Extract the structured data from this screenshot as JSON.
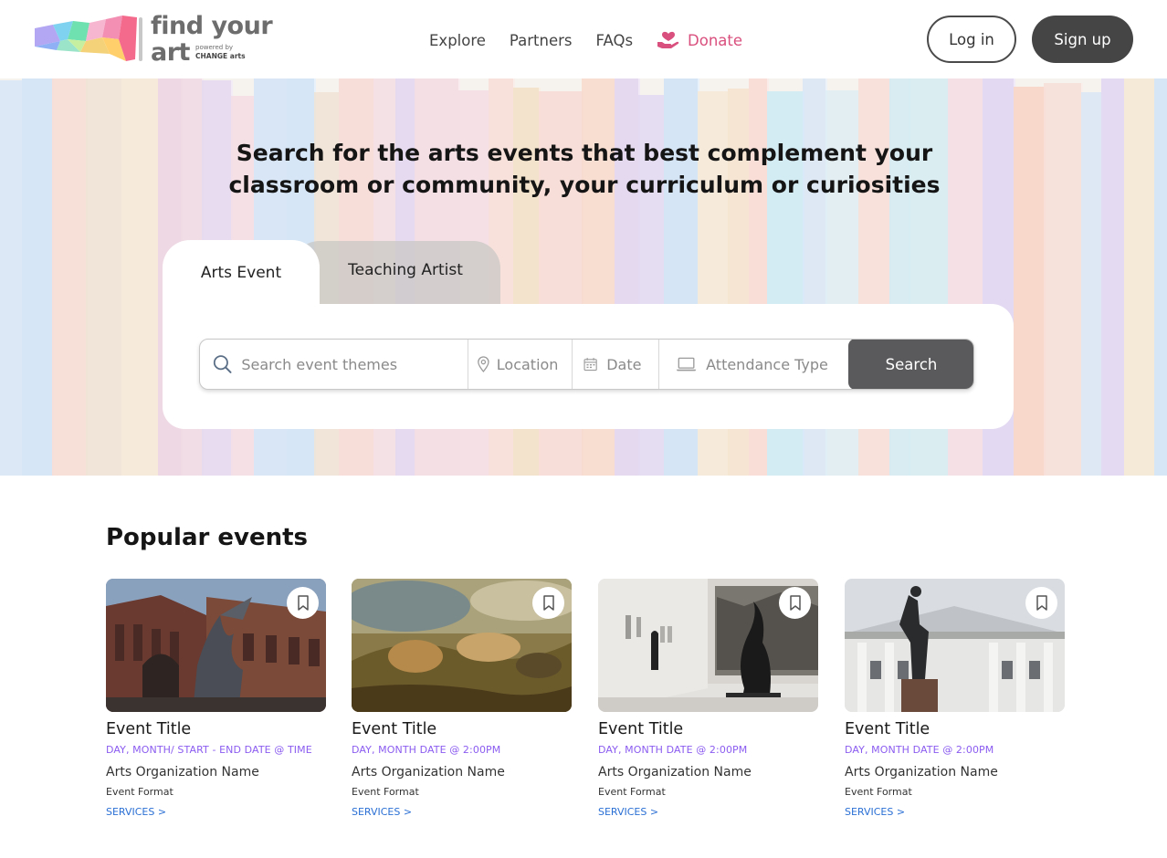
{
  "header": {
    "logo": {
      "line1": "find your",
      "line2": "art",
      "powered_by": "powered by",
      "powered_by_brand": "CHANGE arts"
    },
    "nav": {
      "explore": "Explore",
      "partners": "Partners",
      "faqs": "FAQs",
      "donate": "Donate"
    },
    "login_label": "Log in",
    "signup_label": "Sign up"
  },
  "hero": {
    "title": "Search for the arts events that best complement your classroom or community, your curriculum or curiosities",
    "tabs": [
      {
        "label": "Arts Event",
        "active": true
      },
      {
        "label": "Teaching Artist",
        "active": false
      }
    ],
    "search": {
      "themes_placeholder": "Search event themes",
      "location_placeholder": "Location",
      "date_placeholder": "Date",
      "attendance_placeholder": "Attendance Type",
      "button_label": "Search"
    }
  },
  "popular": {
    "title": "Popular events",
    "services_label": "SERVICES >",
    "events": [
      {
        "title": "Event Title",
        "date": "DAY, MONTH/ START - END DATE @ TIME",
        "organization": "Arts Organization Name",
        "format": "Event Format",
        "image": "gothic-building-angel-statue"
      },
      {
        "title": "Event Title",
        "date": "DAY, MONTH DATE @ 2:00PM",
        "organization": "Arts Organization Name",
        "format": "Event Format",
        "image": "battle-painting"
      },
      {
        "title": "Event Title",
        "date": "DAY, MONTH DATE @ 2:00PM",
        "organization": "Arts Organization Name",
        "format": "Event Format",
        "image": "gallery-sculpture"
      },
      {
        "title": "Event Title",
        "date": "DAY, MONTH DATE @ 2:00PM",
        "organization": "Arts Organization Name",
        "format": "Event Format",
        "image": "monument-theatre-facade"
      }
    ]
  },
  "colors": {
    "donate": "#d94f7d",
    "date_text": "#8b5cf0",
    "services_link": "#2a6fd4",
    "primary_button": "#454545",
    "search_button": "#5a5a5c"
  }
}
